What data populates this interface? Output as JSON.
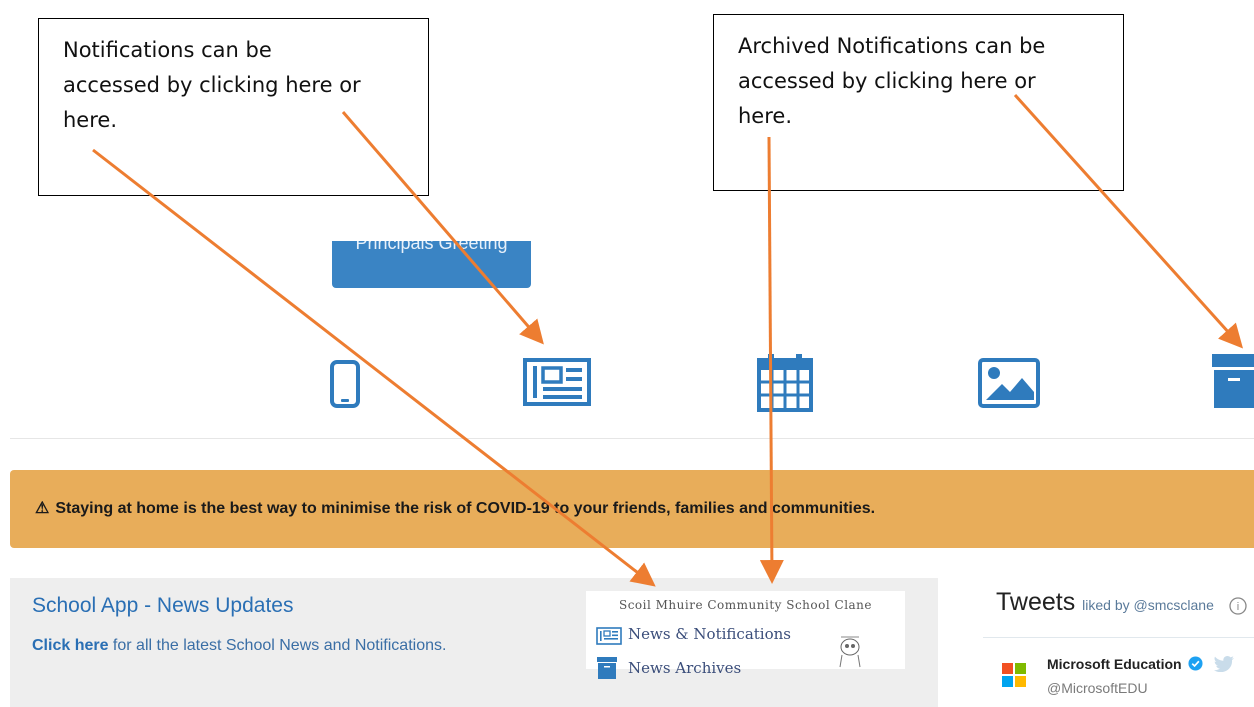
{
  "callouts": {
    "left": [
      "Notifications can be",
      "accessed by clicking here or",
      "here."
    ],
    "right": [
      "Archived Notifications can be",
      "accessed by clicking here or",
      "here."
    ]
  },
  "greeting_button": {
    "label": "Principals Greeting"
  },
  "icon_row": [
    {
      "name": "phone-icon"
    },
    {
      "name": "newspaper-icon"
    },
    {
      "name": "calendar-icon"
    },
    {
      "name": "image-icon"
    },
    {
      "name": "archive-icon"
    }
  ],
  "alert": {
    "text": "Staying at home is the best way to minimise the risk of COVID-19 to your friends, families and communities."
  },
  "news_updates": {
    "title": "School App - News Updates",
    "link_text": "Click here",
    "rest_text": " for all the latest School News and Notifications."
  },
  "app_card": {
    "school_name": "Scoil Mhuire Community School Clane",
    "news_link": "News & Notifications",
    "archive_link": "News Archives"
  },
  "tweets": {
    "heading": "Tweets",
    "liked_by": "liked by @smcsclane",
    "author_name": "Microsoft Education",
    "author_handle": "@MicrosoftEDU"
  },
  "colors": {
    "accent_blue": "#3a84c4",
    "alert_orange": "#e8ad5a",
    "arrow_orange": "#ed7d31"
  }
}
